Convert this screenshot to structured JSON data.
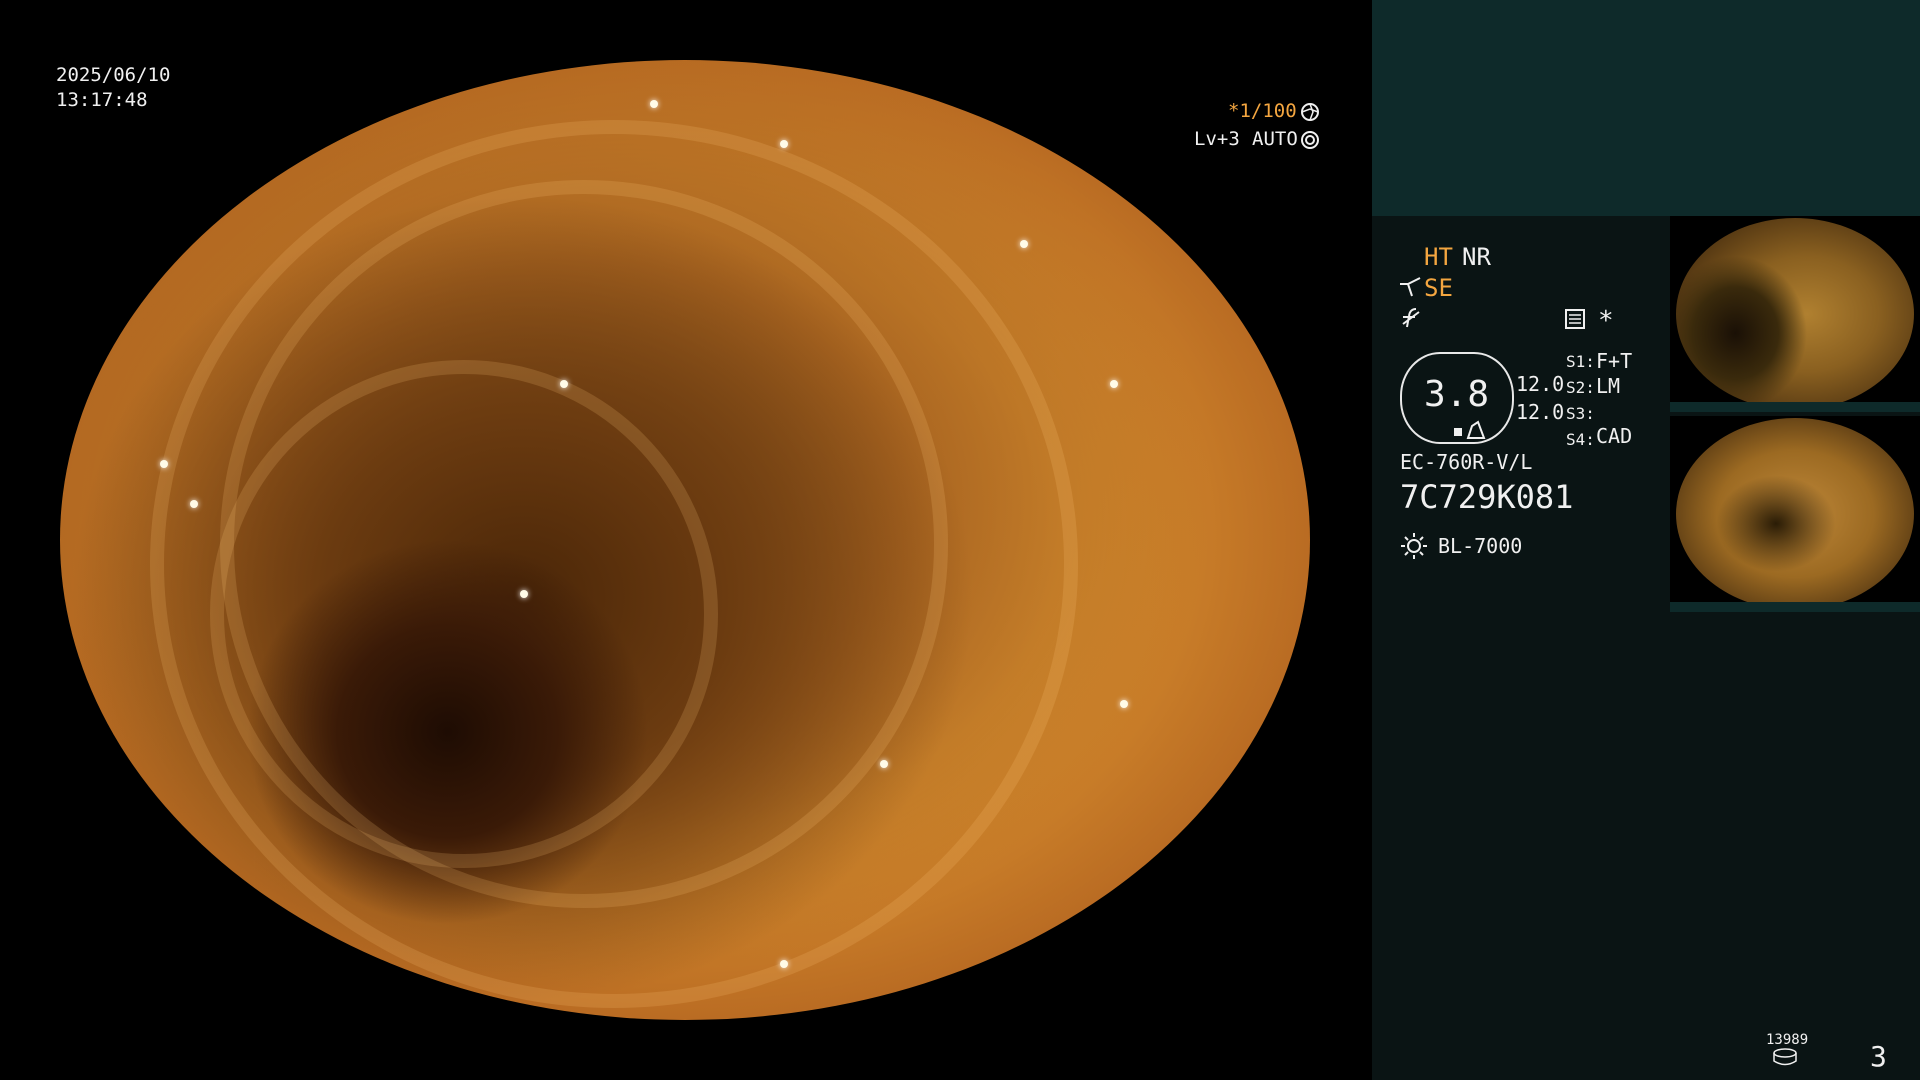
{
  "overlay": {
    "date": "2025/06/10",
    "time": "13:17:48",
    "shutter": "*1/100",
    "shutter_icon": "iris-icon",
    "level": "Lv+3",
    "mode": "AUTO",
    "mode_icon": "auto-iris-icon"
  },
  "panel": {
    "ht": "HT",
    "nr": "NR",
    "se": "SE",
    "se_icon": "enhance-icon",
    "f_icon": "f-mode-icon",
    "menu_icon": "settings-sheet-icon",
    "star": "*",
    "gauge_value": "3.8",
    "v1": "12.0",
    "v2": "12.0",
    "s1_label": "S1:",
    "s1_value": "F+T",
    "s2_label": "S2:",
    "s2_value": "LM",
    "s3_label": "S3:",
    "s3_value": "",
    "s4_label": "S4:",
    "s4_value": "CAD",
    "scope_model": "EC-760R-V/L",
    "serial": "7C729K081",
    "light_source": "BL-7000",
    "counter": "13989",
    "page": "3"
  },
  "colors": {
    "panel_bg": "#0a1414",
    "panel_top": "#0e2a2a",
    "accent": "#f4a640"
  }
}
